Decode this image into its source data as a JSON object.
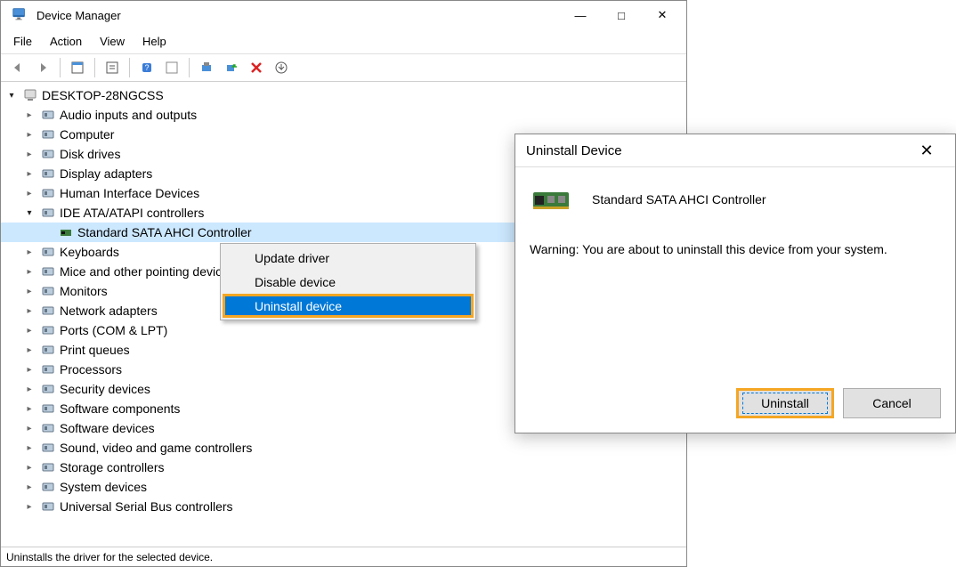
{
  "window": {
    "title": "Device Manager",
    "controls": {
      "minimize": "—",
      "maximize": "□",
      "close": "✕"
    }
  },
  "menu": {
    "file": "File",
    "action": "Action",
    "view": "View",
    "help": "Help"
  },
  "tree": {
    "root": {
      "label": "DESKTOP-28NGCSS"
    },
    "nodes": [
      {
        "label": "Audio inputs and outputs"
      },
      {
        "label": "Computer"
      },
      {
        "label": "Disk drives"
      },
      {
        "label": "Display adapters"
      },
      {
        "label": "Human Interface Devices"
      },
      {
        "label": "IDE ATA/ATAPI controllers",
        "expanded": true,
        "children": [
          {
            "label": "Standard SATA AHCI Controller",
            "selected": true
          }
        ]
      },
      {
        "label": "Keyboards"
      },
      {
        "label": "Mice and other pointing devices"
      },
      {
        "label": "Monitors"
      },
      {
        "label": "Network adapters"
      },
      {
        "label": "Ports (COM & LPT)"
      },
      {
        "label": "Print queues"
      },
      {
        "label": "Processors"
      },
      {
        "label": "Security devices"
      },
      {
        "label": "Software components"
      },
      {
        "label": "Software devices"
      },
      {
        "label": "Sound, video and game controllers"
      },
      {
        "label": "Storage controllers"
      },
      {
        "label": "System devices"
      },
      {
        "label": "Universal Serial Bus controllers"
      }
    ]
  },
  "context": {
    "update": "Update driver",
    "disable": "Disable device",
    "uninstall": "Uninstall device"
  },
  "dialog": {
    "title": "Uninstall Device",
    "device": "Standard SATA AHCI Controller",
    "warning": "Warning: You are about to uninstall this device from your system.",
    "uninstall": "Uninstall",
    "cancel": "Cancel"
  },
  "status": "Uninstalls the driver for the selected device."
}
